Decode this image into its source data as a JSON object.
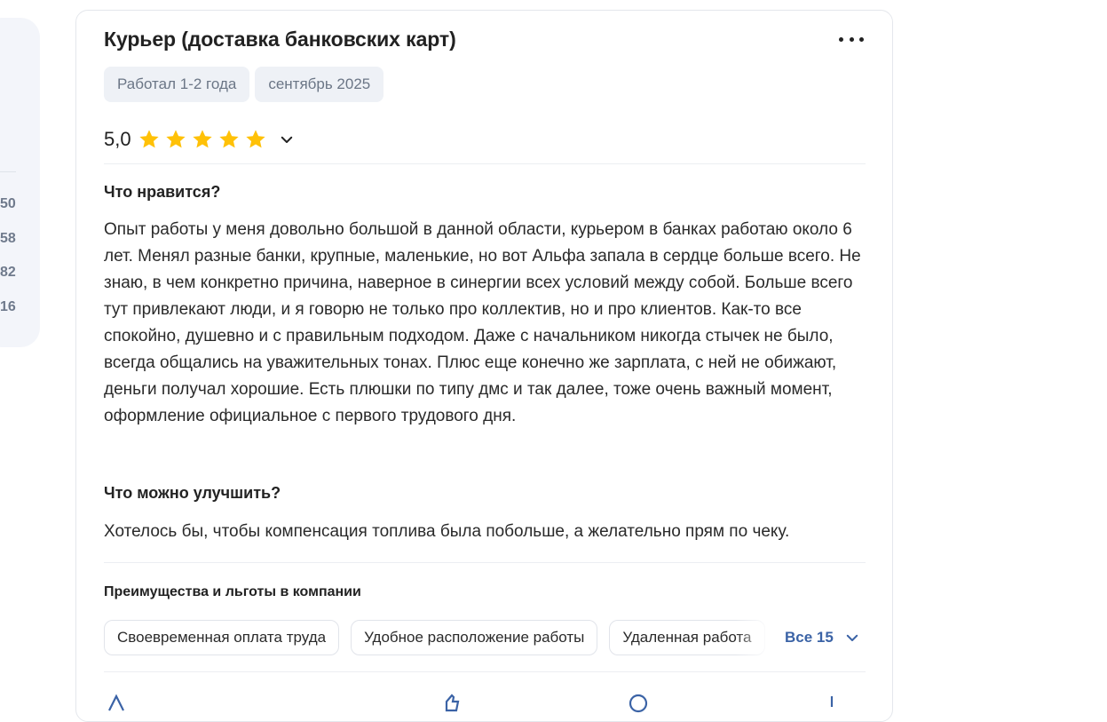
{
  "sidebar": {
    "numbers": [
      "50",
      "58",
      "82",
      "16"
    ]
  },
  "review": {
    "title": "Курьер (доставка банковских карт)",
    "tags": [
      "Работал 1-2 года",
      "сентябрь 2025"
    ],
    "rating": "5,0",
    "stars": 5,
    "star_color": "#FFC107",
    "likes_heading": "Что нравится?",
    "likes_text": "Опыт работы у меня довольно большой в данной области, курьером в банках работаю около 6 лет. Менял разные банки, крупные, маленькие, но вот Альфа запала в сердце больше всего. Не знаю, в чем конкретно причина, наверное в синергии всех условий между собой. Больше всего тут привлекают люди, и я говорю не только про коллектив, но и про клиентов. Как-то все спокойно, душевно и с правильным подходом. Даже с начальником никогда стычек не было, всегда общались на уважительных тонах. Плюс еще конечно же зарплата, с ней не обижают, деньги получал хорошие. Есть плюшки по типу дмс и так далее, тоже очень важный момент, оформление официальное с первого трудового дня.",
    "improve_heading": "Что можно улучшить?",
    "improve_text": "Хотелось бы, чтобы компенсация топлива была побольше, а желательно прям по чеку.",
    "benefits_heading": "Преимущества и льготы в компании",
    "benefits": [
      "Своевременная оплата труда",
      "Удобное расположение работы",
      "Удаленная работа"
    ],
    "all_label": "Все 15",
    "accent_color": "#3B63A6"
  }
}
